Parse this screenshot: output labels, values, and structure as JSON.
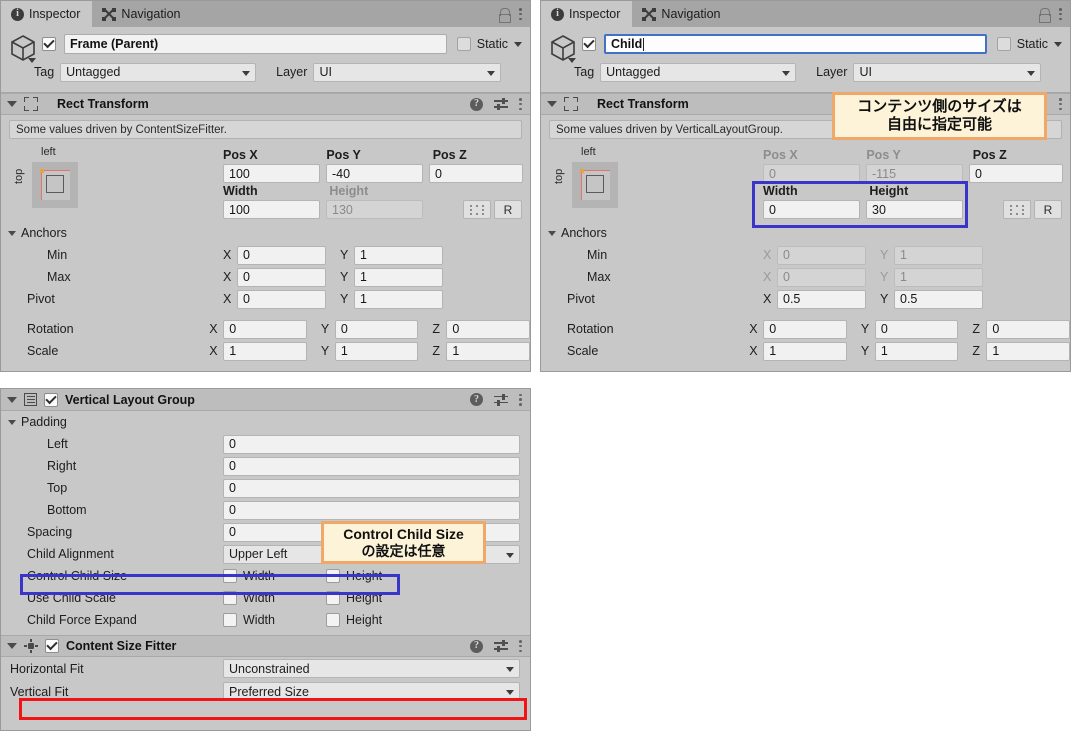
{
  "tabs": {
    "inspector": "Inspector",
    "navigation": "Navigation"
  },
  "left_panel": {
    "object": {
      "name": "Frame (Parent)",
      "enabled": true,
      "static_label": "Static",
      "tag_label": "Tag",
      "tag_value": "Untagged",
      "layer_label": "Layer",
      "layer_value": "UI"
    },
    "rect_transform": {
      "title": "Rect Transform",
      "info": "Some values driven by ContentSizeFitter.",
      "preview_left": "left",
      "preview_top": "top",
      "pos_x_label": "Pos X",
      "pos_x_value": "100",
      "pos_y_label": "Pos Y",
      "pos_y_value": "-40",
      "pos_z_label": "Pos Z",
      "pos_z_value": "0",
      "width_label": "Width",
      "width_value": "100",
      "height_label": "Height",
      "height_value": "130",
      "reset_label": "R",
      "anchors_label": "Anchors",
      "min_label": "Min",
      "min_x": "0",
      "min_y": "1",
      "max_label": "Max",
      "max_x": "0",
      "max_y": "1",
      "pivot_label": "Pivot",
      "pivot_x": "0",
      "pivot_y": "1",
      "rotation_label": "Rotation",
      "rot_x": "0",
      "rot_y": "0",
      "rot_z": "0",
      "scale_label": "Scale",
      "scale_x": "1",
      "scale_y": "1",
      "scale_z": "1",
      "axis_x": "X",
      "axis_y": "Y",
      "axis_z": "Z"
    }
  },
  "right_panel": {
    "object": {
      "name": "Child",
      "enabled": true,
      "static_label": "Static",
      "tag_label": "Tag",
      "tag_value": "Untagged",
      "layer_label": "Layer",
      "layer_value": "UI"
    },
    "rect_transform": {
      "title": "Rect Transform",
      "info": "Some values driven by VerticalLayoutGroup.",
      "preview_left": "left",
      "preview_top": "top",
      "pos_x_label": "Pos X",
      "pos_x_value": "0",
      "pos_y_label": "Pos Y",
      "pos_y_value": "-115",
      "pos_z_label": "Pos Z",
      "pos_z_value": "0",
      "width_label": "Width",
      "width_value": "0",
      "height_label": "Height",
      "height_value": "30",
      "reset_label": "R",
      "anchors_label": "Anchors",
      "min_label": "Min",
      "min_x": "0",
      "min_y": "1",
      "max_label": "Max",
      "max_x": "0",
      "max_y": "1",
      "pivot_label": "Pivot",
      "pivot_x": "0.5",
      "pivot_y": "0.5",
      "rotation_label": "Rotation",
      "rot_x": "0",
      "rot_y": "0",
      "rot_z": "0",
      "scale_label": "Scale",
      "scale_x": "1",
      "scale_y": "1",
      "scale_z": "1",
      "axis_x": "X",
      "axis_y": "Y",
      "axis_z": "Z"
    }
  },
  "vertical_layout_group": {
    "title": "Vertical Layout Group",
    "enabled": true,
    "padding_label": "Padding",
    "left_label": "Left",
    "left_value": "0",
    "right_label": "Right",
    "right_value": "0",
    "top_label": "Top",
    "top_value": "0",
    "bottom_label": "Bottom",
    "bottom_value": "0",
    "spacing_label": "Spacing",
    "spacing_value": "0",
    "child_alignment_label": "Child Alignment",
    "child_alignment_value": "Upper Left",
    "control_child_size_label": "Control Child Size",
    "use_child_scale_label": "Use Child Scale",
    "child_force_expand_label": "Child Force Expand",
    "width_label": "Width",
    "height_label": "Height"
  },
  "content_size_fitter": {
    "title": "Content Size Fitter",
    "enabled": true,
    "horizontal_fit_label": "Horizontal Fit",
    "horizontal_fit_value": "Unconstrained",
    "vertical_fit_label": "Vertical Fit",
    "vertical_fit_value": "Preferred Size"
  },
  "callouts": {
    "content_size": {
      "line1": "コンテンツ側のサイズは",
      "line2": "自由に指定可能"
    },
    "control_child_size": {
      "line1": "Control Child Size",
      "line2": "の設定は任意"
    }
  },
  "colors": {
    "callout_bg": "#fdf3d8",
    "callout_border": "#f0a868",
    "highlight_blue": "#3a34c8",
    "highlight_red": "#f01414",
    "panel_bg": "#c8c8c8",
    "tabbar_bg": "#a5a5a5"
  }
}
